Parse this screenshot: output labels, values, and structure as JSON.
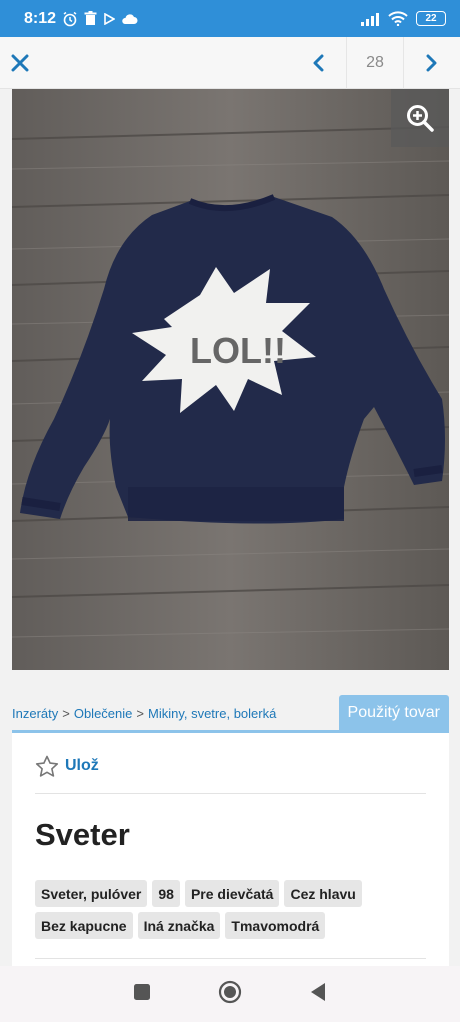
{
  "status_bar": {
    "time": "8:12",
    "battery": "22"
  },
  "top_bar": {
    "counter": "28"
  },
  "breadcrumb": {
    "items": [
      "Inzeráty",
      "Oblečenie",
      "Mikiny, svetre, bolerká"
    ],
    "separator": ">"
  },
  "condition": "Použitý tovar",
  "listing": {
    "save_label": "Ulož",
    "title": "Sveter",
    "tags": [
      "Sveter, pulóver",
      "98",
      "Pre dievčatá",
      "Cez hlavu",
      "Bez kapucne",
      "Iná značka",
      "Tmavomodrá"
    ]
  },
  "photo": {
    "print_text": "LOL!!"
  },
  "colors": {
    "status_bar": "#2f8fd8",
    "accent": "#1e78b8",
    "condition_tab": "#8cc3ea",
    "sweater": "#222a4a"
  }
}
